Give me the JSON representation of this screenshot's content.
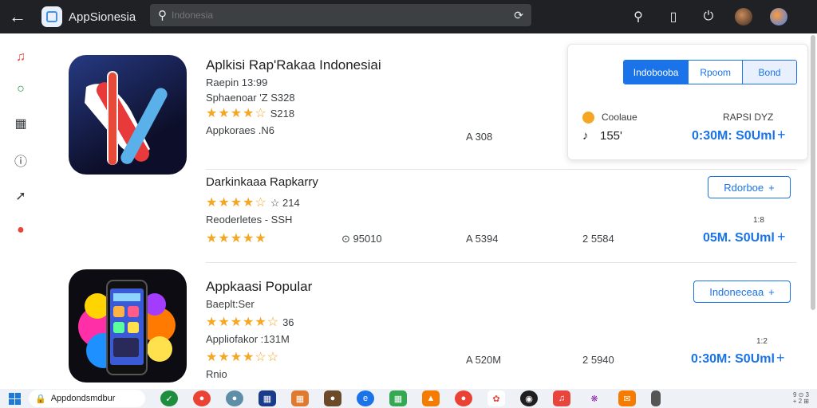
{
  "header": {
    "app_name": "AppSionesia",
    "search_placeholder": "Indonesia",
    "icons": [
      "back-arrow-icon",
      "search-icon",
      "mic-icon",
      "search-icon",
      "device-icon",
      "power-icon",
      "avatar",
      "profile-avatar"
    ]
  },
  "sidebar": {
    "items": [
      {
        "icon": "music-icon",
        "color": "#e8453c"
      },
      {
        "icon": "chat-icon",
        "color": "#1e8e3e"
      },
      {
        "icon": "grid-icon",
        "color": "#3c4043"
      },
      {
        "icon": "info-icon",
        "color": "#3c4043"
      },
      {
        "icon": "link-icon",
        "color": "#3c4043"
      },
      {
        "icon": "profile-icon",
        "color": "#e8453c"
      }
    ]
  },
  "panel": {
    "tabs": [
      "Indobooba",
      "Rpoom",
      "Bond"
    ],
    "label": "Coolaue",
    "label_right": "RAPSI DYZ",
    "count": "155'",
    "price": "0:30M: S0Uml"
  },
  "apps": [
    {
      "title": "Aplkisi Rap'Rakaa Indonesiai",
      "line1": "Raepin 13:99",
      "line2": "Sphaenoar 'Z S328",
      "rating_text": "S218",
      "line3": "Appkoraes .N6",
      "stat": "A 308"
    },
    {
      "title": "Darkinkaaa Rapkarry",
      "rating_text": "☆ 214",
      "line2": "Reoderletes - SSH",
      "stat_a": "⊙ 95010",
      "stat_b": "A 5394",
      "stat_c": "2 5584",
      "small": "1:8",
      "button": "Rdorboe",
      "price": "05M. S0Uml"
    },
    {
      "title": "Appkaasi Popular",
      "line1": "Baeplt:Ser",
      "rating1_text": "36",
      "line2": "Appliofakor :131M",
      "line3": "Rnio",
      "stat_a": "A 520M",
      "stat_b": "2 5940",
      "small": "1:2",
      "button": "Indoneceaa",
      "price": "0:30M: S0Uml"
    }
  ],
  "taskbar": {
    "search_text": "Appdondsmdbur",
    "tray_line1": "9 ⊙ 3",
    "tray_line2": "+ 2 ⊞"
  },
  "colors": {
    "accent": "#1a73e8",
    "topbar": "#202124",
    "star": "#f5a623"
  }
}
